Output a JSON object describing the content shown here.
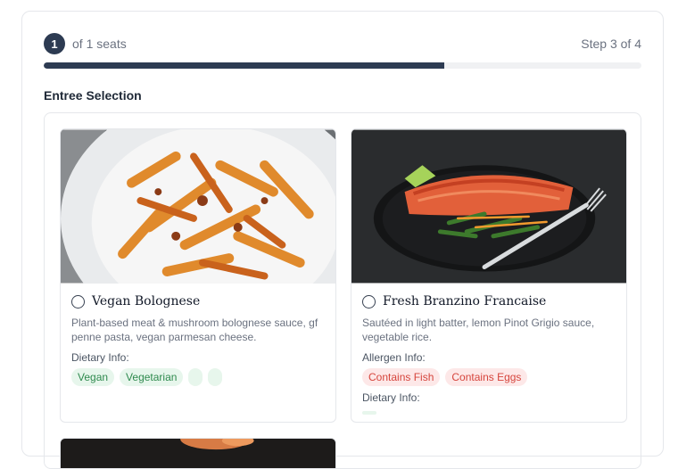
{
  "seats": {
    "current": "1",
    "label": "of 1 seats"
  },
  "step": {
    "label": "Step 3 of 4",
    "progress_fraction": 0.67
  },
  "section_title": "Entree Selection",
  "meals": [
    {
      "name": "Vegan Bolognese",
      "description": "Plant-based meat & mushroom bolognese sauce, gf penne pasta, vegan parmesan cheese.",
      "dietary_label": "Dietary Info:",
      "dietary_tags": [
        "Vegan",
        "Vegetarian"
      ]
    },
    {
      "name": "Fresh Branzino Francaise",
      "description": "Sautéed in light batter, lemon Pinot Grigio sauce, vegetable rice.",
      "allergen_label": "Allergen Info:",
      "allergen_tags": [
        "Contains Fish",
        "Contains Eggs"
      ],
      "dietary_label": "Dietary Info:"
    }
  ],
  "colors": {
    "accent": "#2d3b52",
    "tag_green_bg": "#e7f6ec",
    "tag_green_text": "#2f8a4e",
    "tag_red_bg": "#fde8e8",
    "tag_red_text": "#d6453d"
  }
}
